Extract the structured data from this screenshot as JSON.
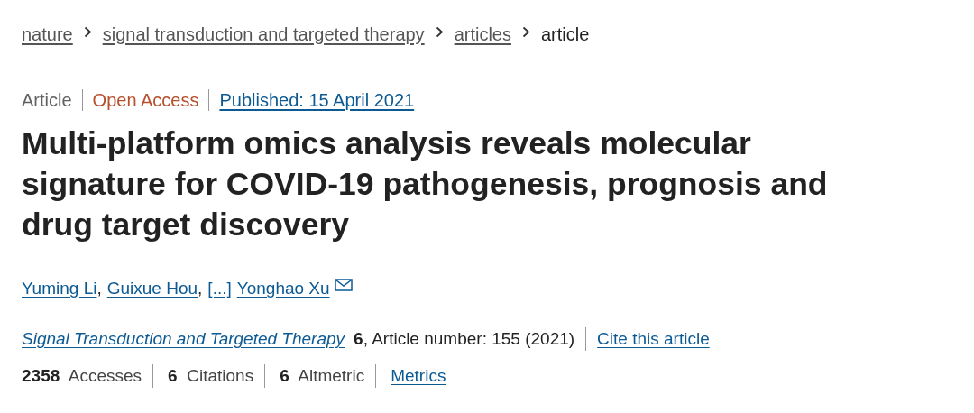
{
  "breadcrumbs": [
    {
      "label": "nature",
      "kind": "link"
    },
    {
      "label": "signal transduction and targeted therapy",
      "kind": "link"
    },
    {
      "label": "articles",
      "kind": "link"
    },
    {
      "label": "article",
      "kind": "current"
    }
  ],
  "meta": {
    "type": "Article",
    "access": "Open Access",
    "published": "Published: 15 April 2021"
  },
  "title": "Multi-platform omics analysis reveals molecular signature for COVID-19 pathogenesis, prognosis and drug target discovery",
  "authors": [
    {
      "name": "Yuming Li",
      "suffix": ",",
      "email": false
    },
    {
      "name": "Guixue Hou",
      "suffix": ",",
      "email": false
    },
    {
      "name": "[...]",
      "email": false
    },
    {
      "name": "Yonghao Xu",
      "email": true
    }
  ],
  "citation": {
    "journal": "Signal Transduction and Targeted Therapy",
    "detail": "**6**, Article number: 155 (2021)",
    "cite": "Cite this article"
  },
  "metrics": [
    "**2358**  Accesses",
    "**6**  Citations",
    "**6**  Altmetric"
  ],
  "metrics_link": "Metrics"
}
